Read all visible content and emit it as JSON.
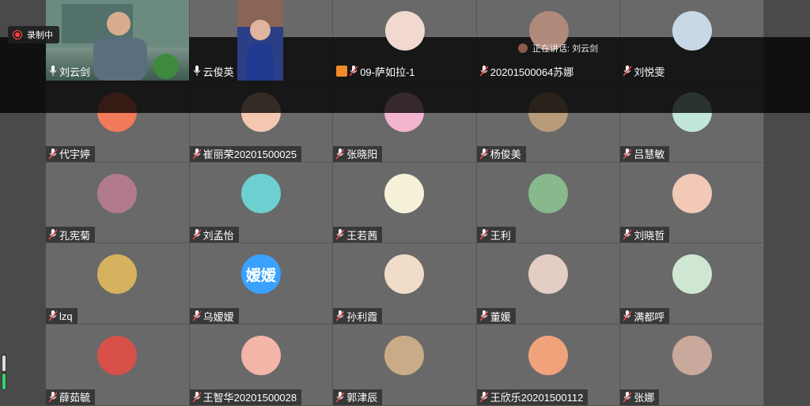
{
  "recording": {
    "label": "录制中"
  },
  "speaking": {
    "label": "正在讲话: 刘云剑"
  },
  "top_participants": [
    {
      "name": "刘云剑",
      "kind": "video"
    },
    {
      "name": "云俊英",
      "kind": "video"
    },
    {
      "name": "09-萨如拉-1",
      "kind": "avatar",
      "color": "#f2d9d0"
    },
    {
      "name": "20201500064苏娜",
      "kind": "avatar",
      "color": "#b08a7a"
    },
    {
      "name": "刘悦雯",
      "kind": "avatar",
      "color": "#c8d8e6"
    }
  ],
  "participants": [
    {
      "name": "代宇婷",
      "color": "#f07a5a"
    },
    {
      "name": "崔丽荣20201500025",
      "color": "#f4c7b0"
    },
    {
      "name": "张晓阳",
      "color": "#f3b4cf"
    },
    {
      "name": "杨俊美",
      "color": "#b89c7a"
    },
    {
      "name": "吕慧敏",
      "color": "#c3e6da"
    },
    {
      "name": "孔宪菊",
      "color": "#b27a8e"
    },
    {
      "name": "刘孟怡",
      "color": "#6ecfd0"
    },
    {
      "name": "王若茜",
      "color": "#f5f1d8"
    },
    {
      "name": "王利",
      "color": "#87b98c"
    },
    {
      "name": "刘晓哲",
      "color": "#f2c8b6"
    },
    {
      "name": "lzq",
      "color": "#d6b25e"
    },
    {
      "name": "乌嫒嫒",
      "color": "#3aa1ff",
      "initials": "嫒嫒"
    },
    {
      "name": "孙利霞",
      "color": "#f0dcc8"
    },
    {
      "name": "董媛",
      "color": "#e4cdc3"
    },
    {
      "name": "满都呼",
      "color": "#cfe6d3"
    },
    {
      "name": "薛茹毓",
      "color": "#d8504a"
    },
    {
      "name": "王智华20201500028",
      "color": "#f3b5a8"
    },
    {
      "name": "郭津辰",
      "color": "#c9ab87"
    },
    {
      "name": "王欣乐20201500112",
      "color": "#f0a37a"
    },
    {
      "name": "张娜",
      "color": "#c9a99b"
    }
  ]
}
